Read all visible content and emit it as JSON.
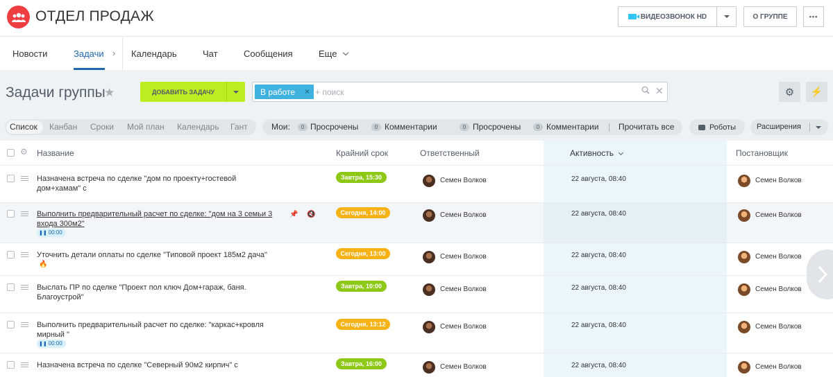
{
  "header": {
    "group_title": "ОТДЕЛ ПРОДАЖ",
    "video_call_label": "ВИДЕОЗВОНОК HD",
    "about_group_label": "О ГРУППЕ",
    "more_label": "•••"
  },
  "nav": {
    "items": [
      {
        "label": "Новости"
      },
      {
        "label": "Задачи"
      },
      {
        "label": "Календарь"
      },
      {
        "label": "Чат"
      },
      {
        "label": "Сообщения"
      },
      {
        "label": "Еще"
      }
    ],
    "active": "Задачи"
  },
  "toolbar": {
    "page_title": "Задачи группы",
    "add_task_label": "ДОБАВИТЬ ЗАДАЧУ",
    "filter_chip": "В работе",
    "search_placeholder": "+ поиск"
  },
  "views": {
    "tabs": [
      {
        "label": "Список"
      },
      {
        "label": "Канбан"
      },
      {
        "label": "Сроки"
      },
      {
        "label": "Мой план"
      },
      {
        "label": "Календарь"
      },
      {
        "label": "Гант"
      }
    ],
    "active": "Список"
  },
  "counters": {
    "my_label": "Мои:",
    "my_overdue": {
      "count": "0",
      "label": "Просрочены"
    },
    "my_comments": {
      "count": "0",
      "label": "Комментарии"
    },
    "overdue": {
      "count": "0",
      "label": "Просрочены"
    },
    "comments": {
      "count": "0",
      "label": "Комментарии"
    },
    "read_all": "Прочитать все"
  },
  "actions": {
    "robots_label": "Роботы",
    "extensions_label": "Расширения"
  },
  "table": {
    "columns": {
      "title": "Название",
      "deadline": "Крайний срок",
      "responsible": "Ответственный",
      "activity": "Активность",
      "creator": "Постановщик"
    },
    "rows": [
      {
        "title": "Назначена встреча по сделке \"дом по проекту+гостевой дом+хамам\" с",
        "deadline": "Завтра, 15:30",
        "deadline_color": "green",
        "responsible": "Семен Волков",
        "activity": "22 августа, 08:40",
        "creator": "Семен Волков"
      },
      {
        "title": "Выполнить предварительный расчет по сделке: \"дом на 3 семьи 3 входа 300м2\"",
        "timer": "00:00",
        "deadline": "Сегодня, 14:00",
        "deadline_color": "orange",
        "responsible": "Семен Волков",
        "activity": "22 августа, 08:40",
        "creator": "Семен Волков"
      },
      {
        "title": "Уточнить детали оплаты по сделке \"Типовой проект 185м2 дача\"",
        "deadline": "Сегодня, 13:00",
        "deadline_color": "orange",
        "responsible": "Семен Волков",
        "activity": "22 августа, 08:40",
        "creator": "Семен Волков"
      },
      {
        "title": "Выслать ПР по сделке \"Проект пол ключ Дом+гараж, баня. Благоустрой\"",
        "deadline": "Завтра, 10:00",
        "deadline_color": "green",
        "responsible": "Семен Волков",
        "activity": "22 августа, 08:40",
        "creator": "Семен Волков"
      },
      {
        "title": "Выполнить предварительный расчет по сделке: \"каркас+кровля мирный \"",
        "timer": "00:00",
        "deadline": "Сегодня, 13:12",
        "deadline_color": "orange",
        "responsible": "Семен Волков",
        "activity": "22 августа, 08:40",
        "creator": "Семен Волков"
      },
      {
        "title": "Назначена встреча по сделке \"Северный 90м2 кирпич\" с",
        "deadline": "Завтра, 16:00",
        "deadline_color": "green",
        "responsible": "Семен Волков",
        "activity": "22 августа, 08:40",
        "creator": "Семен Волков"
      }
    ]
  },
  "colors": {
    "accent_blue": "#2067b0",
    "add_button": "#bbed21",
    "deadline_green": "#8ec816",
    "deadline_orange": "#f7b216",
    "group_avatar": "#ef3e42",
    "filter_chip": "#40b2e0"
  },
  "icons": [
    "group-icon",
    "video-camera-icon",
    "chevron-down-icon",
    "star-icon",
    "search-icon",
    "close-icon",
    "gear-icon",
    "bolt-icon",
    "robot-icon",
    "pin-icon",
    "mute-icon",
    "fire-icon",
    "chevron-right-icon"
  ]
}
